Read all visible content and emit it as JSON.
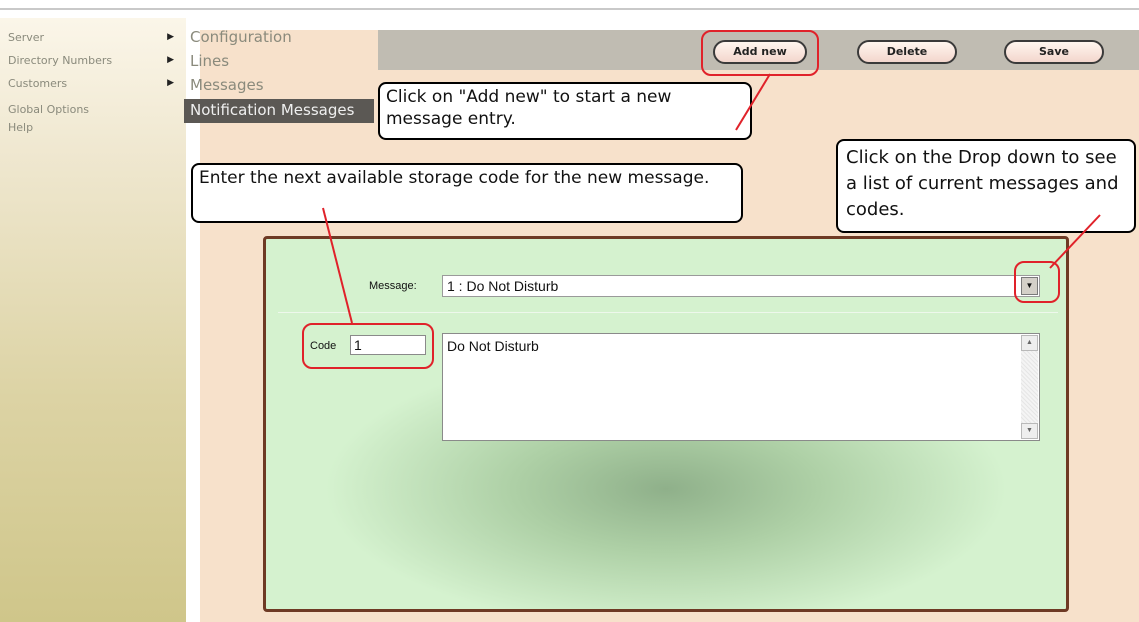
{
  "sidebar": {
    "items": [
      {
        "label": "Server",
        "has_submenu": true
      },
      {
        "label": "Directory Numbers",
        "has_submenu": true
      },
      {
        "label": "Customers",
        "has_submenu": true
      },
      {
        "label": "Global Options",
        "has_submenu": false
      },
      {
        "label": "Help",
        "has_submenu": false
      }
    ],
    "submenu_arrow": "▶"
  },
  "submenu": {
    "items": [
      "Configuration",
      "Lines",
      "Messages",
      "Notification Messages"
    ],
    "active": "Notification Messages"
  },
  "toolbar": {
    "add_new_label": "Add new",
    "delete_label": "Delete",
    "save_label": "Save"
  },
  "callouts": {
    "add_new": "Click on \"Add new\" to start a new message entry.",
    "storage_code": "Enter the next available storage code for the new message.",
    "dropdown": "Click on the Drop down to see a list of current messages and codes."
  },
  "form": {
    "message_label": "Message:",
    "message_selected": "1 : Do Not Disturb",
    "code_label": "Code",
    "code_value": "1",
    "message_text": "Do Not Disturb",
    "dropdown_glyph": "▼",
    "scroll_up_glyph": "▲",
    "scroll_down_glyph": "▼"
  },
  "colors": {
    "content_bg": "#f7e1cb",
    "toolbar_bg": "#c0bcb2",
    "panel_border": "#6e3a24",
    "highlight": "#e0222a",
    "active_submenu_bg": "#5b5854"
  }
}
